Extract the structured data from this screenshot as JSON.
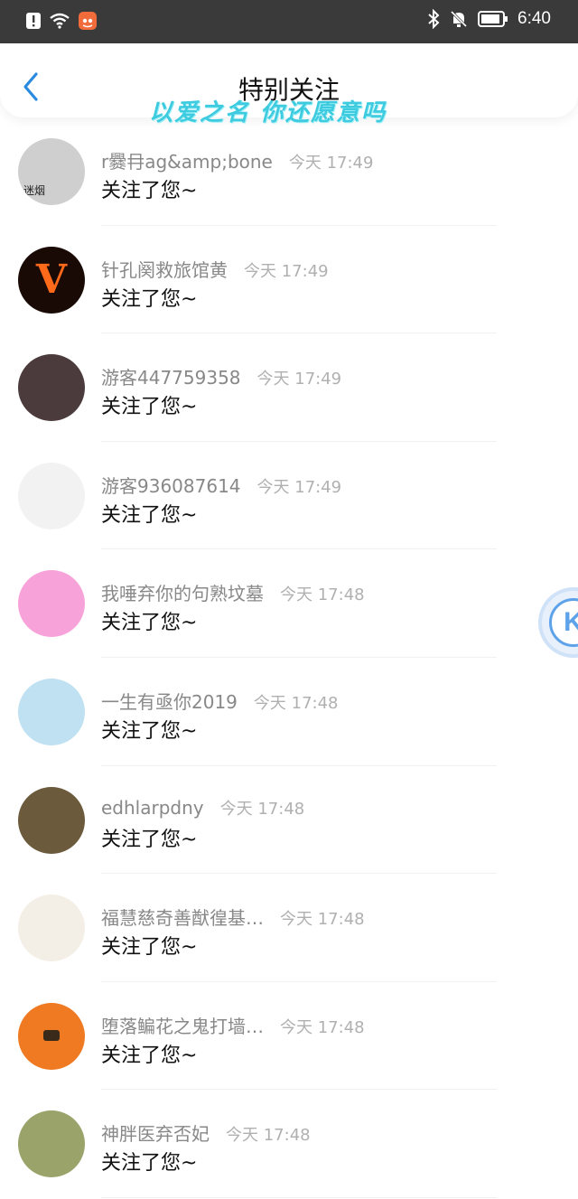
{
  "status_bar": {
    "time": "6:40",
    "left_icons": [
      "alert-icon",
      "wifi-icon",
      "app-notification-icon"
    ],
    "right_icons": [
      "bluetooth-icon",
      "mute-icon",
      "battery-icon"
    ]
  },
  "header": {
    "title": "特别关注",
    "watermark": "以爱之名 你还愿意吗"
  },
  "items": [
    {
      "name": "r爨冄ag&amp;bone",
      "time": "今天 17:49",
      "message": "关注了您~",
      "avatar_color": "#cfcfcf",
      "avatar_text": "迷烟"
    },
    {
      "name": "针孔阕救旅馆黄",
      "time": "今天 17:49",
      "message": "关注了您~",
      "avatar_color": "#1a0a05",
      "avatar_text": "V"
    },
    {
      "name": "游客447759358",
      "time": "今天 17:49",
      "message": "关注了您~",
      "avatar_color": "#4b3b3c",
      "avatar_text": ""
    },
    {
      "name": "游客936087614",
      "time": "今天 17:49",
      "message": "关注了您~",
      "avatar_color": "#f2f2f2",
      "avatar_text": ""
    },
    {
      "name": "我唾弃你的句熟坟墓",
      "time": "今天 17:48",
      "message": "关注了您~",
      "avatar_color": "#f7a3d9",
      "avatar_text": ""
    },
    {
      "name": "一生有亟你2019",
      "time": "今天 17:48",
      "message": "关注了您~",
      "avatar_color": "#bfe1f2",
      "avatar_text": ""
    },
    {
      "name": "edhlarpdny",
      "time": "今天 17:48",
      "message": "关注了您~",
      "avatar_color": "#6b5a3c",
      "avatar_text": ""
    },
    {
      "name": "福慧慈奇善猷徨基…",
      "time": "今天 17:48",
      "message": "关注了您~",
      "avatar_color": "#f4efe6",
      "avatar_text": ""
    },
    {
      "name": "堕落鳊花之鬼打墙…",
      "time": "今天 17:48",
      "message": "关注了您~",
      "avatar_color": "#ef7a22",
      "avatar_text": ""
    },
    {
      "name": "神胖医弃否妃",
      "time": "今天 17:48",
      "message": "关注了您~",
      "avatar_color": "#9aa36a",
      "avatar_text": ""
    }
  ],
  "floating_button": {
    "label": "K"
  },
  "colors": {
    "status_bar_bg": "#3a3a3a",
    "accent": "#2a8ae0",
    "name_text": "#888888",
    "time_text": "#b0b0b0"
  }
}
